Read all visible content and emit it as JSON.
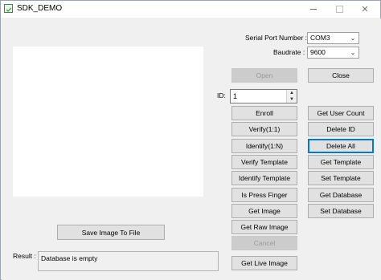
{
  "window": {
    "title": "SDK_DEMO",
    "minimize_glyph": "—",
    "close_glyph": "✕"
  },
  "serial": {
    "port_label": "Serial Port Number :",
    "port_value": "COM3",
    "baud_label": "Baudrate :",
    "baud_value": "9600",
    "arrow_glyph": "⌄"
  },
  "buttons": {
    "open": "Open",
    "close": "Close",
    "enroll": "Enroll",
    "verify": "Verify(1:1)",
    "identify": "Identify(1:N)",
    "verify_template": "Verify Template",
    "identify_template": "Identify Template",
    "is_press_finger": "Is Press Finger",
    "get_image": "Get Image",
    "get_raw_image": "Get Raw Image",
    "cancel": "Cancel",
    "get_live_image": "Get Live Image",
    "get_user_count": "Get User Count",
    "delete_id": "Delete ID",
    "delete_all": "Delete All",
    "get_template": "Get Template",
    "set_template": "Set Template",
    "get_database": "Get Database",
    "set_database": "Set Database",
    "save_image": "Save Image To File"
  },
  "id_field": {
    "label": "ID:",
    "value": "1",
    "up_glyph": "▲",
    "down_glyph": "▼"
  },
  "result": {
    "label": "Result :",
    "text": "Database is empty"
  }
}
